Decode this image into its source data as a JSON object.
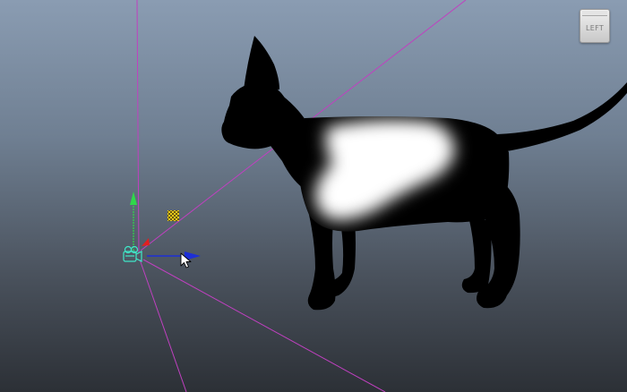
{
  "viewport": {
    "view_cube": {
      "label": "LEFT"
    },
    "background_colors": [
      "#8a9cb2",
      "#6f7f92",
      "#4a525d",
      "#2c3036"
    ],
    "frustum_line_color": "#c040c0",
    "axis_colors": {
      "y": "#2fd84a",
      "z": "#1d2fd6",
      "x": "#e02020"
    },
    "camera_icon_color": "#3fe8c8",
    "pivot_handle_color": "#e8c81a",
    "model": {
      "name": "cat",
      "body_color": "#000000",
      "patch_color": "#ffffff"
    }
  }
}
